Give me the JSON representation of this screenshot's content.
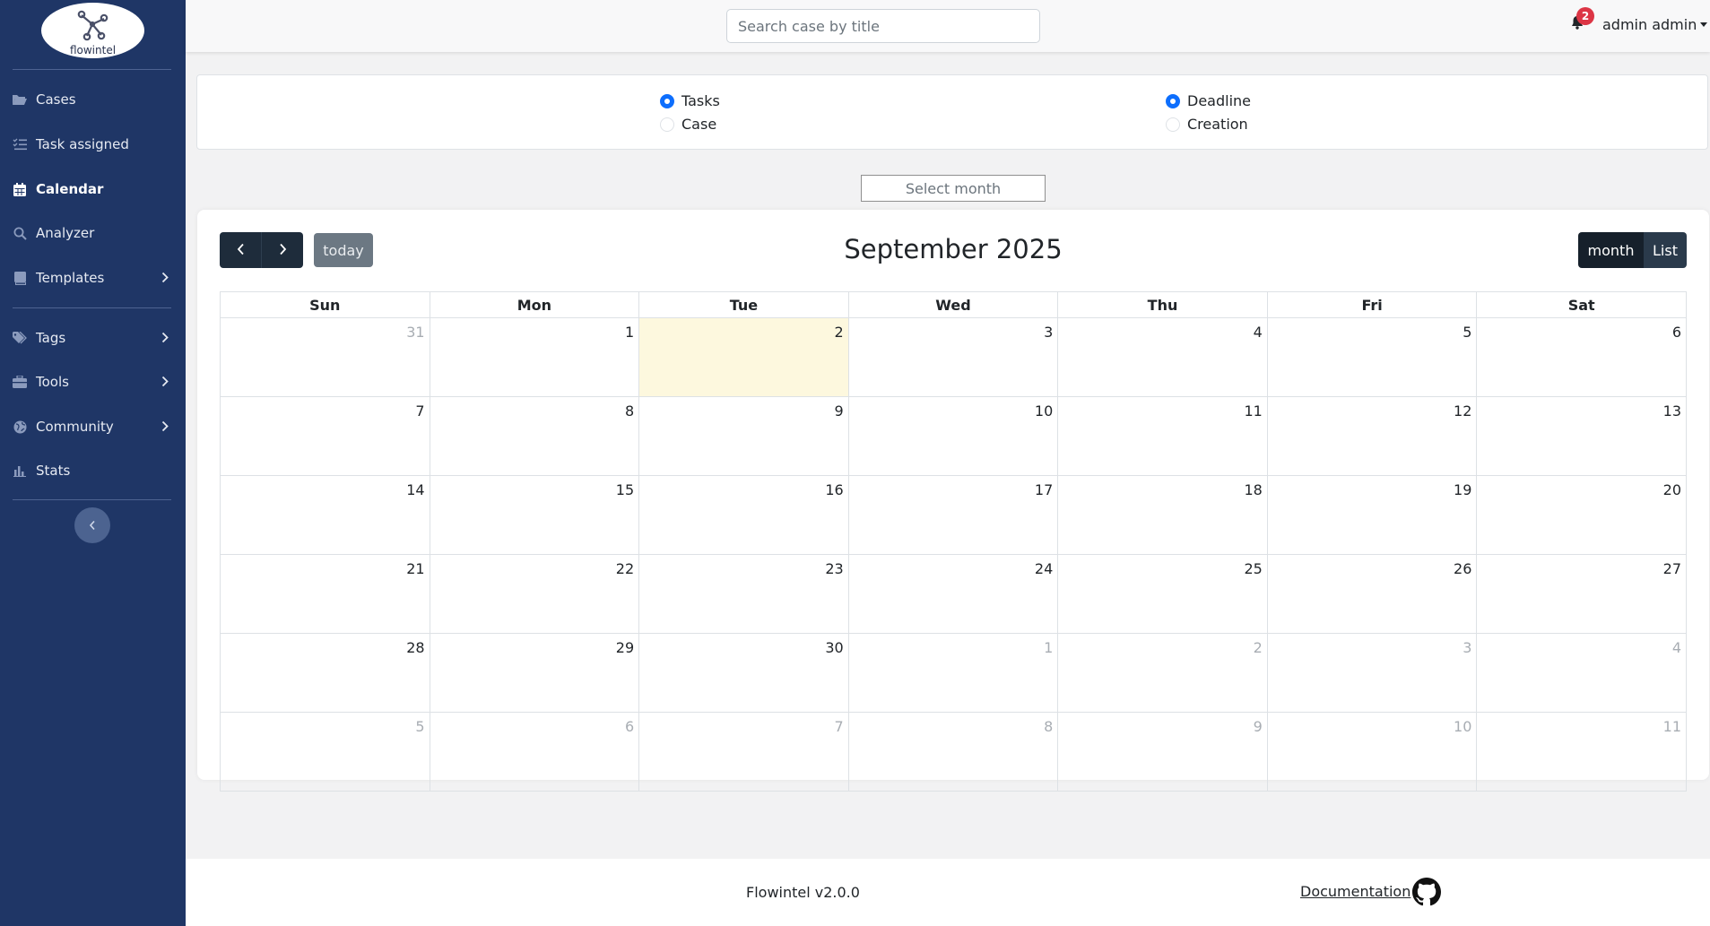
{
  "app": {
    "logo_text": "flowintel"
  },
  "sidebar": {
    "items": [
      {
        "label": "Cases",
        "icon": "folder-open-icon"
      },
      {
        "label": "Task assigned",
        "icon": "list-check-icon"
      },
      {
        "label": "Calendar",
        "icon": "calendar-icon",
        "active": true
      },
      {
        "label": "Analyzer",
        "icon": "search-icon"
      },
      {
        "label": "Templates",
        "icon": "book-icon",
        "has_submenu": true
      },
      {
        "label": "Tags",
        "icon": "tags-icon",
        "has_submenu": true
      },
      {
        "label": "Tools",
        "icon": "toolbox-icon",
        "has_submenu": true
      },
      {
        "label": "Community",
        "icon": "globe-icon",
        "has_submenu": true
      },
      {
        "label": "Stats",
        "icon": "chart-bar-icon"
      }
    ]
  },
  "topbar": {
    "search_placeholder": "Search case by title",
    "notification_count": "2",
    "user_name": "admin admin"
  },
  "filters": {
    "type_options": [
      {
        "label": "Tasks",
        "checked": true
      },
      {
        "label": "Case",
        "checked": false
      }
    ],
    "date_options": [
      {
        "label": "Deadline",
        "checked": true
      },
      {
        "label": "Creation",
        "checked": false
      }
    ],
    "month_placeholder": "Select month"
  },
  "calendar": {
    "title": "September 2025",
    "today_label": "today",
    "view_month_label": "month",
    "view_list_label": "List",
    "weekdays": [
      "Sun",
      "Mon",
      "Tue",
      "Wed",
      "Thu",
      "Fri",
      "Sat"
    ],
    "weeks": [
      [
        "31",
        "1",
        "2",
        "3",
        "4",
        "5",
        "6"
      ],
      [
        "7",
        "8",
        "9",
        "10",
        "11",
        "12",
        "13"
      ],
      [
        "14",
        "15",
        "16",
        "17",
        "18",
        "19",
        "20"
      ],
      [
        "21",
        "22",
        "23",
        "24",
        "25",
        "26",
        "27"
      ],
      [
        "28",
        "29",
        "30",
        "1",
        "2",
        "3",
        "4"
      ],
      [
        "5",
        "6",
        "7",
        "8",
        "9",
        "10",
        "11"
      ]
    ],
    "today_date": "2"
  },
  "footer": {
    "version": "Flowintel v2.0.0",
    "documentation_label": "Documentation"
  },
  "colors": {
    "sidebar_bg": "#1f3666",
    "today_highlight": "#fdf8de",
    "radio_checked": "#0d6efd",
    "badge": "#dc3545",
    "dark_button": "#1e2c3b"
  }
}
